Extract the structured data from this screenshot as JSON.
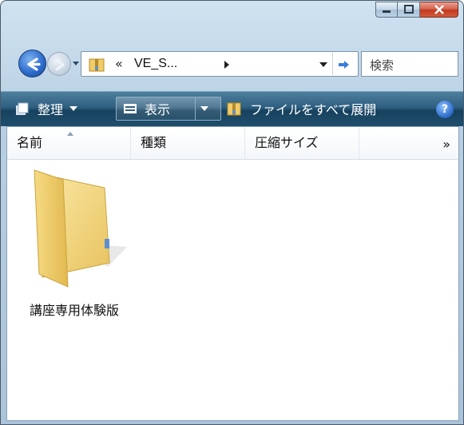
{
  "window": {
    "caption_buttons": [
      "minimize",
      "maximize",
      "close"
    ]
  },
  "address_bar": {
    "prefix": "«",
    "path": "VE_S..."
  },
  "search": {
    "placeholder": "検索"
  },
  "toolbar": {
    "organize_label": "整理",
    "views_label": "表示",
    "extract_label": "ファイルをすべて展開",
    "help_label": "?"
  },
  "columns": {
    "name": "名前",
    "type": "種類",
    "compressed_size": "圧縮サイズ",
    "more": "»"
  },
  "items": [
    {
      "label": "講座専用体験版",
      "icon": "folder-icon"
    }
  ],
  "colors": {
    "command_bar": "#1f4e6c",
    "close_button": "#c0391f",
    "back_button": "#2f6ecf",
    "folder": "#f3d77e"
  }
}
